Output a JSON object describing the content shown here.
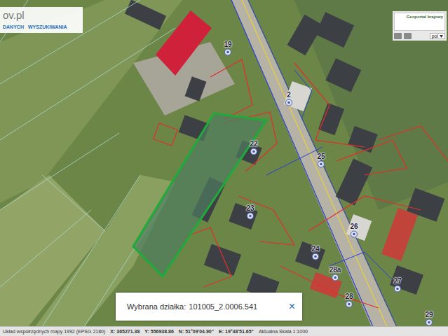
{
  "logo": {
    "text": "ov.pl"
  },
  "menu": [
    "DANYCH",
    "WYSZUKIWANIA"
  ],
  "map_service": {
    "title": "Geoportal krajowy"
  },
  "language": {
    "value": "pol"
  },
  "address_pins": [
    {
      "label": "19"
    },
    {
      "label": "2"
    },
    {
      "label": "22"
    },
    {
      "label": "25"
    },
    {
      "label": "23"
    },
    {
      "label": "26"
    },
    {
      "label": "24"
    },
    {
      "label": "28a"
    },
    {
      "label": "27"
    },
    {
      "label": "28"
    },
    {
      "label": "29"
    }
  ],
  "selection_popup": {
    "label": "Wybrana działka:",
    "value": "101005_2.0006.541",
    "close": "×"
  },
  "status_bar": {
    "crs": "Układ współrzędnych mapy 1992 (EPSG 2180)",
    "x": "X: 365271.38",
    "y": "Y: 556938.86",
    "n": "N: 51°09'04.90\"",
    "e": "E: 19°48'51.65\"",
    "scale": "Aktualna Skala 1:1000"
  }
}
